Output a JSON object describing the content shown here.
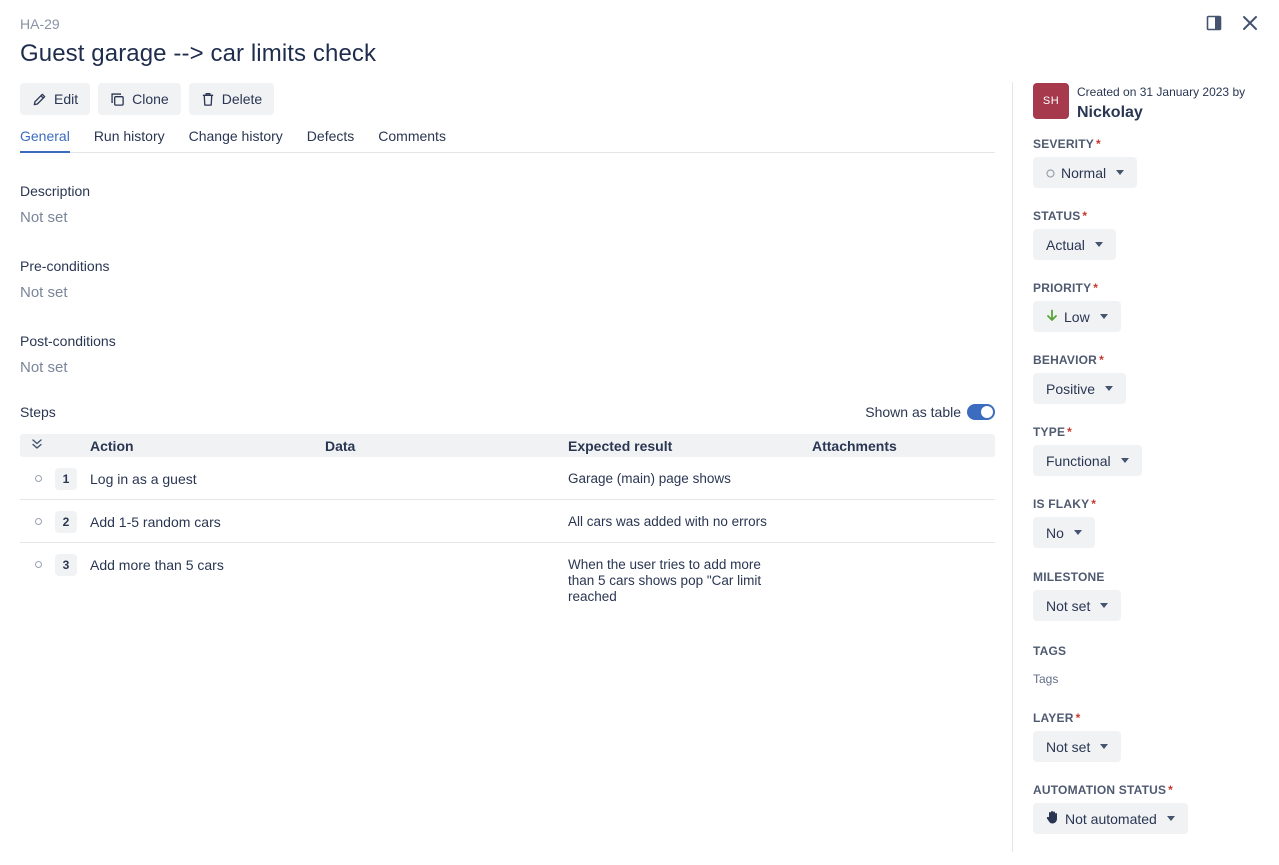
{
  "header": {
    "key": "HA-29",
    "title": "Guest garage --> car limits check"
  },
  "toolbar": {
    "edit_label": "Edit",
    "clone_label": "Clone",
    "delete_label": "Delete"
  },
  "tabs": [
    {
      "label": "General",
      "active": true
    },
    {
      "label": "Run history"
    },
    {
      "label": "Change history"
    },
    {
      "label": "Defects"
    },
    {
      "label": "Comments"
    }
  ],
  "sections": {
    "description": {
      "label": "Description",
      "value": "Not set"
    },
    "preconditions": {
      "label": "Pre-conditions",
      "value": "Not set"
    },
    "postconditions": {
      "label": "Post-conditions",
      "value": "Not set"
    }
  },
  "steps": {
    "label": "Steps",
    "shown_as_table_label": "Shown as table",
    "columns": {
      "action": "Action",
      "data": "Data",
      "expected": "Expected result",
      "attachments": "Attachments"
    },
    "rows": [
      {
        "num": "1",
        "action": "Log in as a guest",
        "data": "",
        "expected": "Garage (main) page shows",
        "attachments": ""
      },
      {
        "num": "2",
        "action": "Add 1-5 random cars",
        "data": "",
        "expected": "All cars was added with no errors",
        "attachments": ""
      },
      {
        "num": "3",
        "action": "Add more than 5 cars",
        "data": "",
        "expected": "When the user tries to add more than 5 cars shows pop \"Car limit reached",
        "attachments": ""
      }
    ]
  },
  "sidebar": {
    "avatar_initials": "SH",
    "created_text": "Created on 31 January 2023 by",
    "creator_name": "Nickolay",
    "severity": {
      "label": "SEVERITY",
      "value": "Normal"
    },
    "status": {
      "label": "STATUS",
      "value": "Actual"
    },
    "priority": {
      "label": "PRIORITY",
      "value": "Low"
    },
    "behavior": {
      "label": "BEHAVIOR",
      "value": "Positive"
    },
    "type": {
      "label": "TYPE",
      "value": "Functional"
    },
    "is_flaky": {
      "label": "IS FLAKY",
      "value": "No"
    },
    "milestone": {
      "label": "MILESTONE",
      "value": "Not set"
    },
    "tags": {
      "label": "TAGS",
      "placeholder": "Tags"
    },
    "layer": {
      "label": "LAYER",
      "value": "Not set"
    },
    "automation_status": {
      "label": "AUTOMATION STATUS",
      "value": "Not automated"
    },
    "required_mark": "*"
  },
  "colors": {
    "accent": "#3b6cc0",
    "avatar": "#a6394c",
    "priority_low_arrow": "#57a53a",
    "required": "#c9372c"
  }
}
